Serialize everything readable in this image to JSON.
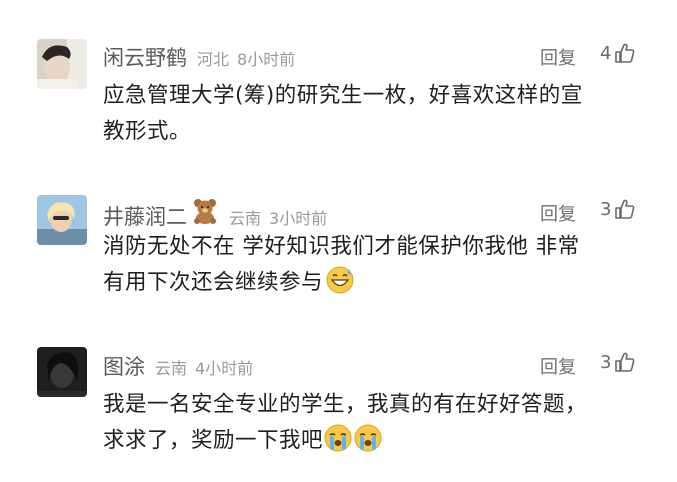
{
  "comments": [
    {
      "username": "闲云野鹤",
      "location": "河北",
      "time": "8小时前",
      "reply_label": "回复",
      "likes": "4",
      "text_lines": [
        "应急管理大学(筹)的研究生一枚，好喜欢这样的宣",
        "教形式。"
      ]
    },
    {
      "username": "井藤润二",
      "location": "云南",
      "time": "3小时前",
      "reply_label": "回复",
      "likes": "3",
      "text_lines": [
        "消防无处不在 学好知识我们才能保护你我他 非常",
        "有用下次还会继续参与"
      ]
    },
    {
      "username": "图涂",
      "location": "云南",
      "time": "4小时前",
      "reply_label": "回复",
      "likes": "3",
      "text_lines": [
        "我是一名安全专业的学生，我真的有在好好答题，",
        "求求了，奖励一下我吧"
      ]
    }
  ],
  "icons": {
    "thumb": "thumbs-up-outline-icon",
    "badge": "teddy-bear-icon",
    "emoji_grin": "grinning-sweat-emoji",
    "emoji_cry": "loudly-crying-emoji"
  }
}
